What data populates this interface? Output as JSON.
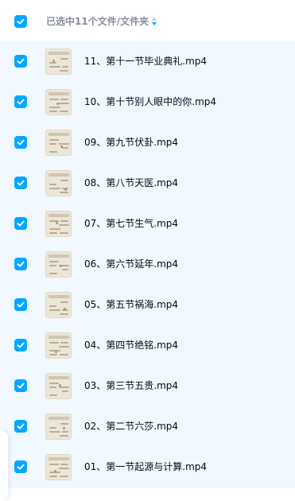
{
  "header": {
    "label": "已选中11个文件/文件夹",
    "sort_icon": "sort-arrows-icon",
    "select_all_checked": true
  },
  "colors": {
    "accent": "#06a7ff",
    "list_bg": "#f1f8ff",
    "text": "#03081a",
    "header_text": "#878c9c"
  },
  "files": [
    {
      "name": "11、第十一节毕业典礼.mp4",
      "checked": true,
      "thumb_icon": "video-thumbnail-icon"
    },
    {
      "name": "10、第十节别人眼中的你.mp4",
      "checked": true,
      "thumb_icon": "video-thumbnail-icon"
    },
    {
      "name": "09、第九节伏卦.mp4",
      "checked": true,
      "thumb_icon": "video-thumbnail-icon"
    },
    {
      "name": "08、第八节天医.mp4",
      "checked": true,
      "thumb_icon": "video-thumbnail-icon"
    },
    {
      "name": "07、第七节生气.mp4",
      "checked": true,
      "thumb_icon": "video-thumbnail-icon"
    },
    {
      "name": "06、第六节延年.mp4",
      "checked": true,
      "thumb_icon": "video-thumbnail-icon"
    },
    {
      "name": "05、第五节祸海.mp4",
      "checked": true,
      "thumb_icon": "video-thumbnail-icon"
    },
    {
      "name": "04、第四节绝铭.mp4",
      "checked": true,
      "thumb_icon": "video-thumbnail-icon"
    },
    {
      "name": "03、第三节五贵.mp4",
      "checked": true,
      "thumb_icon": "video-thumbnail-icon"
    },
    {
      "name": "02、第二节六莎.mp4",
      "checked": true,
      "thumb_icon": "video-thumbnail-icon"
    },
    {
      "name": "01、第一节起源与计算.mp4",
      "checked": true,
      "thumb_icon": "video-thumbnail-icon"
    }
  ]
}
